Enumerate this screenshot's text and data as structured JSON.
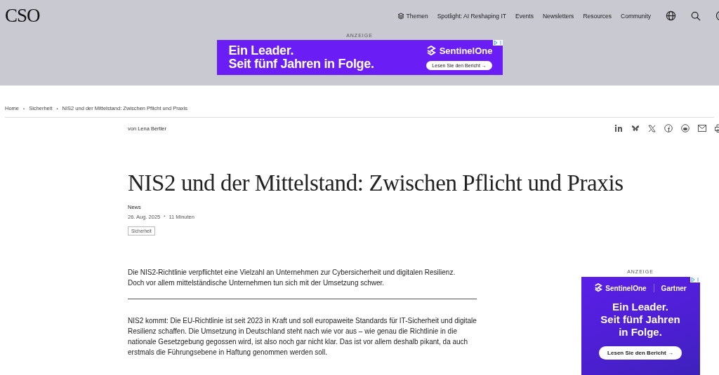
{
  "header": {
    "logo": "CSO",
    "nav": [
      {
        "label": "Themen",
        "kind": "topics"
      },
      {
        "label": "Spotlight: AI Reshaping IT",
        "kind": "link"
      },
      {
        "label": "Events",
        "kind": "link"
      },
      {
        "label": "Newsletters",
        "kind": "link"
      },
      {
        "label": "Resources",
        "kind": "link"
      },
      {
        "label": "Community",
        "kind": "link"
      }
    ]
  },
  "top_ad": {
    "label": "ANZEIGE",
    "headline": [
      "Ein Leader.",
      "Seit fünf Jahren in Folge."
    ],
    "brand": "SentinelOne",
    "cta": "Lesen Sie den Bericht",
    "cta_arrow": "→"
  },
  "breadcrumb": [
    "Home",
    "Sicherheit",
    "NIS2 und der Mittelstand: Zwischen Pflicht und Praxis"
  ],
  "breadcrumb_separator": "•",
  "author": "von Lena Bertler",
  "article": {
    "title": "NIS2 und der Mittelstand: Zwischen Pflicht und Praxis",
    "category": "News",
    "date": "26. Aug. 2025",
    "read_time": "11 Minuten",
    "tag": "Sicherheit",
    "lead": "Die NIS2-Richtlinie verpflichtet eine Vielzahl an Unternehmen zur Cybersicherheit und digitalen Resilienz. Doch vor allem mittelständische Unternehmen tun sich mit der Umsetzung schwer.",
    "body": "NIS2 kommt: Die EU-Richtlinie ist seit 2023 in Kraft und soll europaweite Standards für IT-Sicherheit und digitale Resilienz schaffen. Die Umsetzung in Deutschland steht nach wie vor aus – wie genau die Richtlinie in die nationale Gesetzgebung gegossen wird, ist also noch gar nicht klar. Das ist vor allem deshalb pikant, da auch erstmals die Führungsebene in Haftung genommen werden soll."
  },
  "side_ad": {
    "label": "ANZEIGE",
    "brand": "SentinelOne",
    "partner": "Gartner",
    "headline": [
      "Ein Leader.",
      "Seit fünf Jahren",
      "in Folge."
    ],
    "cta": "Lesen Sie den Bericht",
    "cta_arrow": "→"
  }
}
